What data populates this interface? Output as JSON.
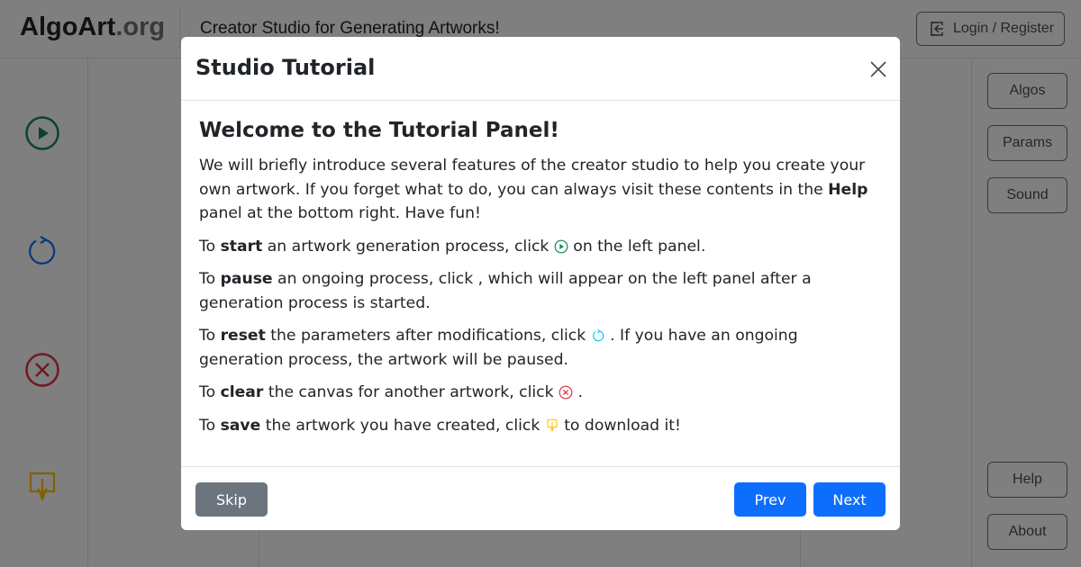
{
  "navbar": {
    "brand_main": "AlgoArt",
    "brand_tld": ".org",
    "tagline": "Creator Studio for Generating Artworks!",
    "login_label": "Login / Register"
  },
  "left_panel": {
    "tools": [
      {
        "icon": "play-icon",
        "color": "#198754"
      },
      {
        "icon": "reset-icon",
        "color": "#0d6efd"
      },
      {
        "icon": "clear-icon",
        "color": "#dc3545"
      },
      {
        "icon": "save-icon",
        "color": "#ffc107"
      }
    ]
  },
  "right_panel": {
    "top_buttons": [
      "Algos",
      "Params",
      "Sound"
    ],
    "bottom_buttons": [
      "Help",
      "About"
    ]
  },
  "modal": {
    "title": "Studio Tutorial",
    "heading": "Welcome to the Tutorial Panel!",
    "intro": {
      "before": "We will briefly introduce several features of the creator studio to help you create your own artwork. If you forget what to do, you can always visit these contents in the ",
      "bold": "Help",
      "after": " panel at the bottom right. Have fun!"
    },
    "start": {
      "prefix": "To ",
      "bold": "start",
      "middle": " an artwork generation process, click ",
      "suffix": " on the left panel."
    },
    "pause": {
      "prefix": "To ",
      "bold": "pause",
      "middle": " an ongoing process, click , which will appear on the left panel after a generation process is started."
    },
    "reset": {
      "prefix": "To ",
      "bold": "reset",
      "middle": " the parameters after modifications, click ",
      "suffix": " . If you have an ongoing generation process, the artwork will be paused."
    },
    "clear": {
      "prefix": "To ",
      "bold": "clear",
      "middle": " the canvas for another artwork, click ",
      "suffix": " ."
    },
    "save": {
      "prefix": "To ",
      "bold": "save",
      "middle": " the artwork you have created, click ",
      "suffix": " to download it!"
    },
    "skip_label": "Skip",
    "prev_label": "Prev",
    "next_label": "Next"
  },
  "colors": {
    "primary": "#0d6efd",
    "secondary": "#6c757d",
    "success": "#198754",
    "danger": "#dc3545",
    "warning": "#ffc107"
  }
}
